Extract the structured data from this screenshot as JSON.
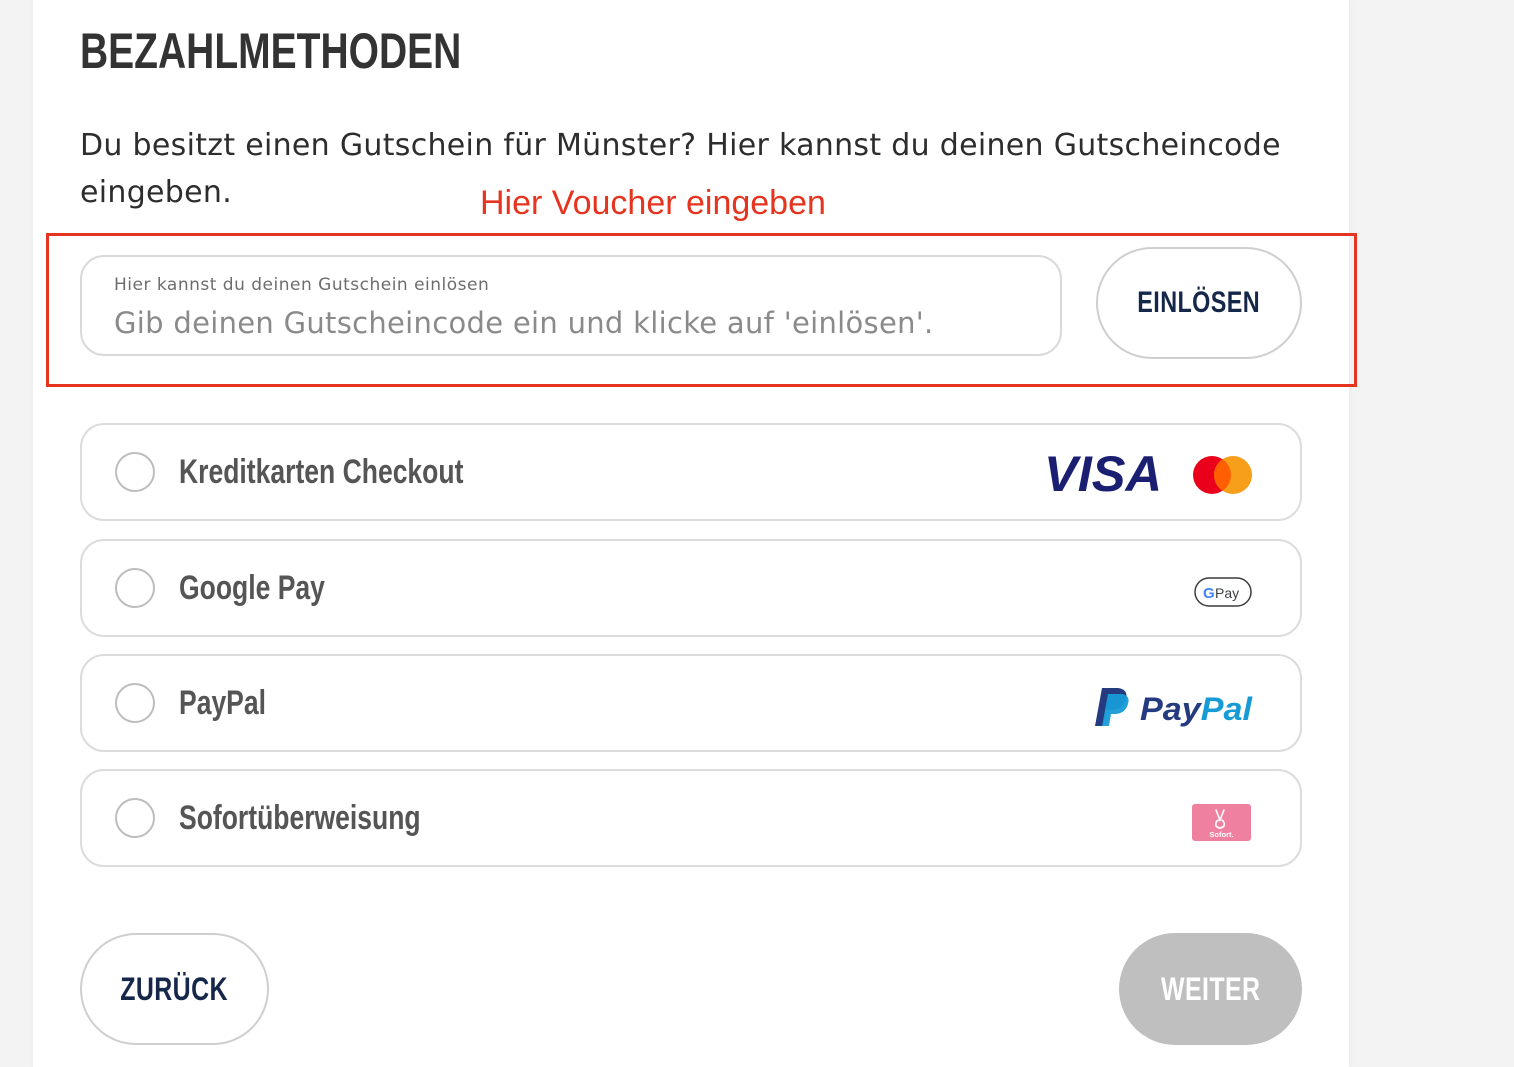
{
  "section": {
    "title": "BEZAHLMETHODEN",
    "intro": "Du besitzt einen Gutschein für Münster? Hier kannst du deinen Gutscheincode eingeben."
  },
  "annotation": {
    "label": "Hier Voucher eingeben",
    "color": "#e5341f"
  },
  "voucher": {
    "field_label": "Hier kannst du deinen Gutschein einlösen",
    "placeholder": "Gib deinen Gutscheincode ein und klicke auf 'einlösen'.",
    "value": "",
    "redeem_label": "EINLÖSEN"
  },
  "payment_options": [
    {
      "label": "Kreditkarten Checkout",
      "logos": [
        "VISA",
        "mastercard-icon"
      ]
    },
    {
      "label": "Google Pay",
      "logos": [
        "G Pay"
      ]
    },
    {
      "label": "PayPal",
      "logos": [
        "PayPal"
      ]
    },
    {
      "label": "Sofortüberweisung",
      "logos": [
        "Sofort."
      ]
    }
  ],
  "logo_text": {
    "visa": "VISA",
    "gpay_g": "G",
    "gpay_pay": "Pay",
    "paypal": "PayPal",
    "sofort": "Sofort."
  },
  "navigation": {
    "back_label": "ZURÜCK",
    "next_label": "WEITER"
  },
  "colors": {
    "brand_navy": "#16284a",
    "disabled_gray": "#bfbfbf",
    "visa_blue": "#1a1f71",
    "mastercard_red": "#eb001b",
    "mastercard_orange": "#f79e1b",
    "paypal_dark": "#253b80",
    "paypal_light": "#179bd7",
    "sofort_pink": "#ef809f"
  }
}
